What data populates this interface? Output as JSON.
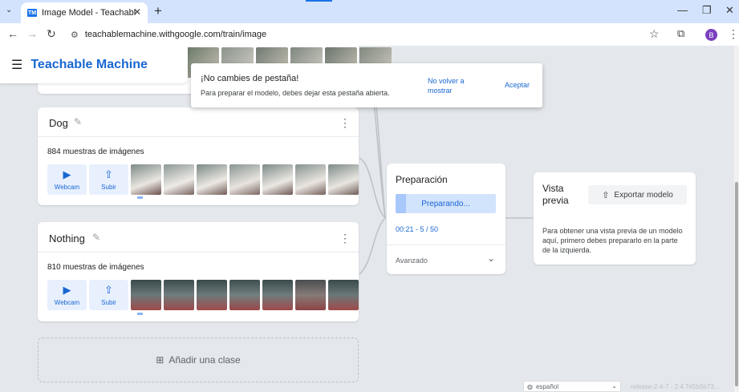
{
  "browser": {
    "tab_title": "Image Model - Teachable Machi",
    "favicon_text": "TM",
    "url": "teachablemachine.withgoogle.com/train/image",
    "profile_initial": "B"
  },
  "app": {
    "brand": "Teachable Machine"
  },
  "toast": {
    "title": "¡No cambies de pestaña!",
    "message": "Para preparar el modelo, debes dejar esta pestaña abierta.",
    "dont_show": "No volver a mostrar",
    "accept": "Aceptar"
  },
  "classes": [
    {
      "name": "Dog",
      "samples": "884 muestras de imágenes",
      "webcam": "Webcam",
      "upload": "Subir"
    },
    {
      "name": "Nothing",
      "samples": "810 muestras de imágenes",
      "webcam": "Webcam",
      "upload": "Subir"
    }
  ],
  "add_class": "Añadir una clase",
  "training": {
    "title": "Preparación",
    "button": "Preparando...",
    "progress_text": "00:21 - 5 / 50",
    "progress_fraction": 0.1,
    "advanced": "Avanzado"
  },
  "preview": {
    "title": "Vista previa",
    "export": "Exportar modelo",
    "text": "Para obtener una vista previa de un modelo aquí, primero debes prepararlo en la parte de la izquierda."
  },
  "footer": {
    "language": "español",
    "release": "release-2-4-7 - 2.4.7#5b5b73..."
  },
  "icons": {
    "menu": "hamburger-icon",
    "edit": "pencil-icon",
    "more": "more-vert-icon",
    "webcam": "videocam-icon",
    "upload": "upload-icon",
    "add": "add-box-icon",
    "export": "upload-icon",
    "chevron": "chevron-down-icon"
  },
  "colors": {
    "accent": "#1967d2",
    "button_bg": "#e8f0fe",
    "background": "#e4e7eb"
  }
}
